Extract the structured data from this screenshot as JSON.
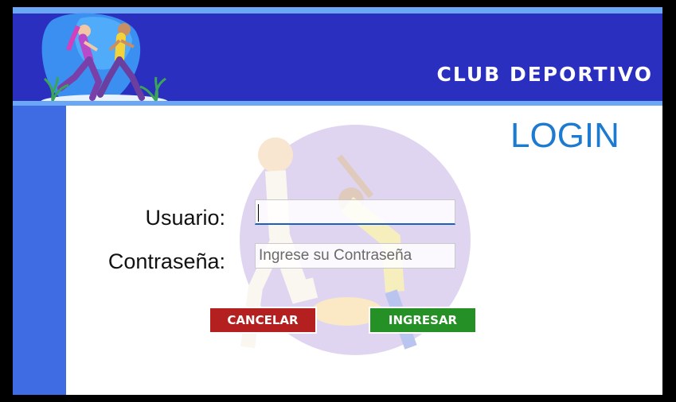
{
  "header": {
    "title": "CLUB DEPORTIVO",
    "logo_icon": "runners-logo-icon"
  },
  "login": {
    "title": "LOGIN",
    "user_label": "Usuario:",
    "user_value": "",
    "password_label": "Contraseña:",
    "password_placeholder": "Ingrese su Contraseña",
    "cancel_label": "CANCELAR",
    "submit_label": "INGRESAR"
  },
  "colors": {
    "header": "#2b2fbf",
    "accent_strip": "#6aa8f5",
    "sidebar": "#3f6be3",
    "login_title": "#1c7bd0",
    "cancel": "#b3201f",
    "submit": "#249025"
  }
}
